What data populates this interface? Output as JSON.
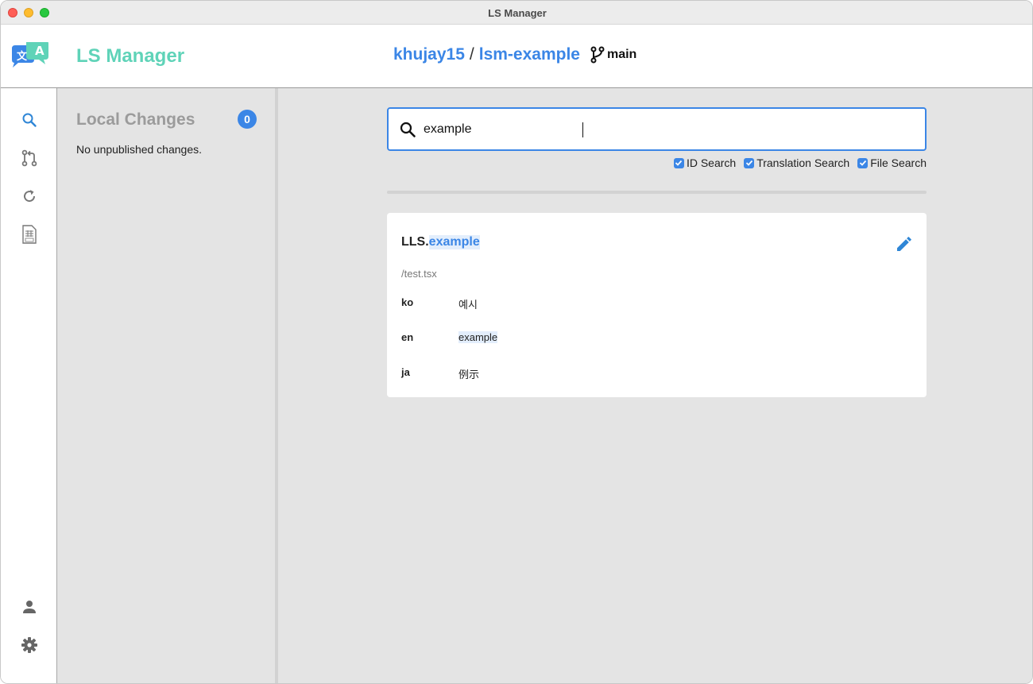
{
  "window": {
    "title": "LS Manager"
  },
  "header": {
    "app_name": "LS Manager",
    "owner": "khujay15",
    "separator": "/",
    "repo": "lsm-example",
    "branch": "main"
  },
  "rail": {
    "items": [
      {
        "icon": "search-icon",
        "active": true
      },
      {
        "icon": "pull-request-icon",
        "active": false
      },
      {
        "icon": "refresh-icon",
        "active": false
      },
      {
        "icon": "spreadsheet-file-icon",
        "active": false
      },
      {
        "icon": "user-icon",
        "active": false
      },
      {
        "icon": "gear-icon",
        "active": false
      }
    ]
  },
  "local_changes": {
    "title": "Local Changes",
    "count": "0",
    "empty_text": "No unpublished changes."
  },
  "search": {
    "value": "example",
    "options": [
      {
        "label": "ID Search",
        "checked": true
      },
      {
        "label": "Translation Search",
        "checked": true
      },
      {
        "label": "File Search",
        "checked": true
      }
    ]
  },
  "results": [
    {
      "id_prefix": "LLS.",
      "id_match": "example",
      "file": "/test.tsx",
      "translations": [
        {
          "lang": "ko",
          "value": "예시",
          "highlight": false
        },
        {
          "lang": "en",
          "value": "example",
          "highlight": true
        },
        {
          "lang": "ja",
          "value": "例示",
          "highlight": false
        }
      ]
    }
  ],
  "colors": {
    "accent": "#3b86e6",
    "brand_teal": "#5fd3b8",
    "panel_bg": "#e4e4e4"
  }
}
